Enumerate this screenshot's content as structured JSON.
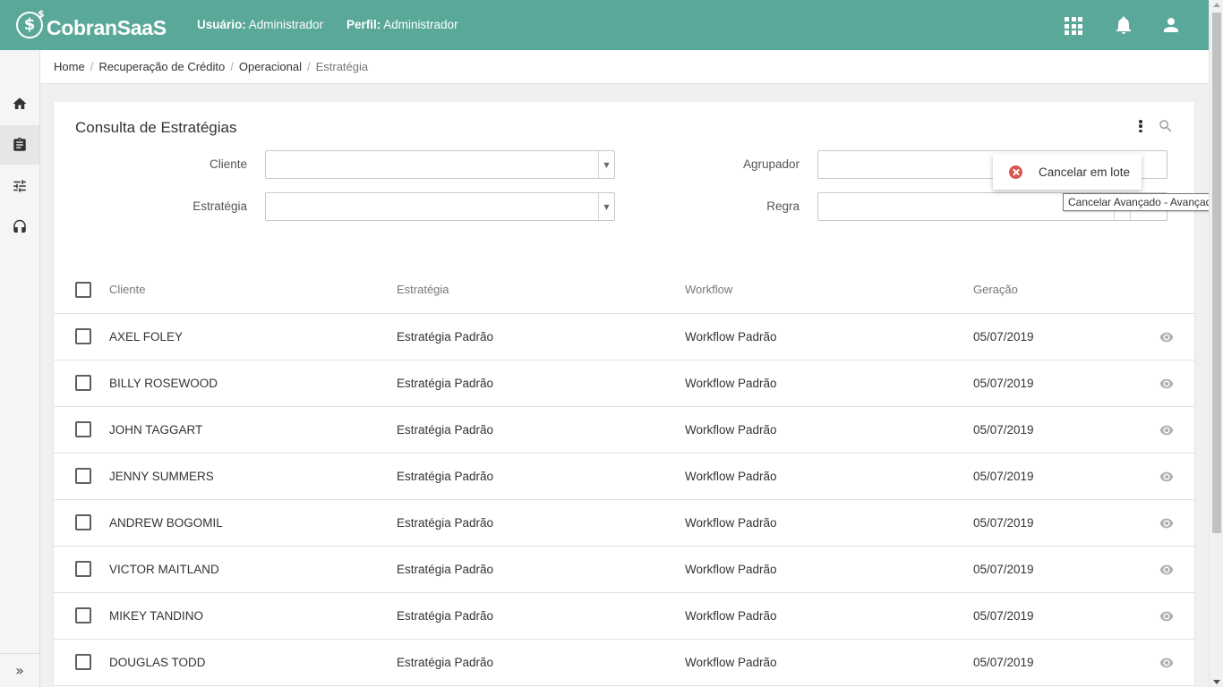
{
  "app": {
    "name": "CobranSaaS",
    "user_label": "Usuário:",
    "user_value": "Administrador",
    "profile_label": "Perfil:",
    "profile_value": "Administrador"
  },
  "breadcrumb": [
    "Home",
    "Recuperação de Crédito",
    "Operacional",
    "Estratégia"
  ],
  "page": {
    "title": "Consulta de Estratégias"
  },
  "filters": {
    "cliente_label": "Cliente",
    "estrategia_label": "Estratégia",
    "agrupador_label": "Agrupador",
    "regra_label": "Regra"
  },
  "menu": {
    "cancel_batch": "Cancelar em lote"
  },
  "tooltip": "Cancelar Avançado - Avançado",
  "table": {
    "headers": [
      "Cliente",
      "Estratégia",
      "Workflow",
      "Geração"
    ],
    "rows": [
      [
        "AXEL FOLEY",
        "Estratégia Padrão",
        "Workflow Padrão",
        "05/07/2019"
      ],
      [
        "BILLY ROSEWOOD",
        "Estratégia Padrão",
        "Workflow Padrão",
        "05/07/2019"
      ],
      [
        "JOHN TAGGART",
        "Estratégia Padrão",
        "Workflow Padrão",
        "05/07/2019"
      ],
      [
        "JENNY SUMMERS",
        "Estratégia Padrão",
        "Workflow Padrão",
        "05/07/2019"
      ],
      [
        "ANDREW BOGOMIL",
        "Estratégia Padrão",
        "Workflow Padrão",
        "05/07/2019"
      ],
      [
        "VICTOR MAITLAND",
        "Estratégia Padrão",
        "Workflow Padrão",
        "05/07/2019"
      ],
      [
        "MIKEY TANDINO",
        "Estratégia Padrão",
        "Workflow Padrão",
        "05/07/2019"
      ],
      [
        "DOUGLAS TODD",
        "Estratégia Padrão",
        "Workflow Padrão",
        "05/07/2019"
      ]
    ]
  },
  "colors": {
    "header": "#5aa899",
    "cancel": "#d9534f"
  },
  "icons": [
    "apps-icon",
    "bell-icon",
    "user-icon",
    "home-icon",
    "clipboard-icon",
    "sliders-icon",
    "headset-icon",
    "expand-icon",
    "kebab-icon",
    "search-icon",
    "cancel-icon",
    "eye-icon"
  ]
}
